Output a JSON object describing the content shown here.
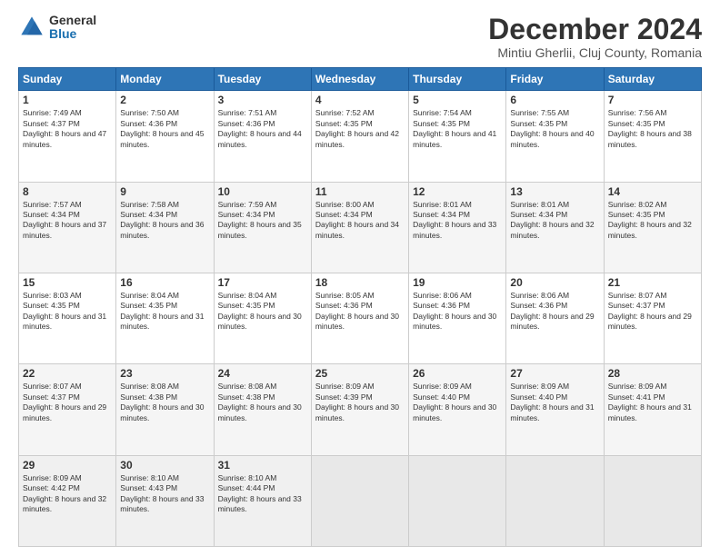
{
  "logo": {
    "general": "General",
    "blue": "Blue"
  },
  "header": {
    "title": "December 2024",
    "subtitle": "Mintiu Gherlii, Cluj County, Romania"
  },
  "weekdays": [
    "Sunday",
    "Monday",
    "Tuesday",
    "Wednesday",
    "Thursday",
    "Friday",
    "Saturday"
  ],
  "weeks": [
    [
      {
        "day": "1",
        "sunrise": "7:49 AM",
        "sunset": "4:37 PM",
        "daylight": "8 hours and 47 minutes."
      },
      {
        "day": "2",
        "sunrise": "7:50 AM",
        "sunset": "4:36 PM",
        "daylight": "8 hours and 45 minutes."
      },
      {
        "day": "3",
        "sunrise": "7:51 AM",
        "sunset": "4:36 PM",
        "daylight": "8 hours and 44 minutes."
      },
      {
        "day": "4",
        "sunrise": "7:52 AM",
        "sunset": "4:35 PM",
        "daylight": "8 hours and 42 minutes."
      },
      {
        "day": "5",
        "sunrise": "7:54 AM",
        "sunset": "4:35 PM",
        "daylight": "8 hours and 41 minutes."
      },
      {
        "day": "6",
        "sunrise": "7:55 AM",
        "sunset": "4:35 PM",
        "daylight": "8 hours and 40 minutes."
      },
      {
        "day": "7",
        "sunrise": "7:56 AM",
        "sunset": "4:35 PM",
        "daylight": "8 hours and 38 minutes."
      }
    ],
    [
      {
        "day": "8",
        "sunrise": "7:57 AM",
        "sunset": "4:34 PM",
        "daylight": "8 hours and 37 minutes."
      },
      {
        "day": "9",
        "sunrise": "7:58 AM",
        "sunset": "4:34 PM",
        "daylight": "8 hours and 36 minutes."
      },
      {
        "day": "10",
        "sunrise": "7:59 AM",
        "sunset": "4:34 PM",
        "daylight": "8 hours and 35 minutes."
      },
      {
        "day": "11",
        "sunrise": "8:00 AM",
        "sunset": "4:34 PM",
        "daylight": "8 hours and 34 minutes."
      },
      {
        "day": "12",
        "sunrise": "8:01 AM",
        "sunset": "4:34 PM",
        "daylight": "8 hours and 33 minutes."
      },
      {
        "day": "13",
        "sunrise": "8:01 AM",
        "sunset": "4:34 PM",
        "daylight": "8 hours and 32 minutes."
      },
      {
        "day": "14",
        "sunrise": "8:02 AM",
        "sunset": "4:35 PM",
        "daylight": "8 hours and 32 minutes."
      }
    ],
    [
      {
        "day": "15",
        "sunrise": "8:03 AM",
        "sunset": "4:35 PM",
        "daylight": "8 hours and 31 minutes."
      },
      {
        "day": "16",
        "sunrise": "8:04 AM",
        "sunset": "4:35 PM",
        "daylight": "8 hours and 31 minutes."
      },
      {
        "day": "17",
        "sunrise": "8:04 AM",
        "sunset": "4:35 PM",
        "daylight": "8 hours and 30 minutes."
      },
      {
        "day": "18",
        "sunrise": "8:05 AM",
        "sunset": "4:36 PM",
        "daylight": "8 hours and 30 minutes."
      },
      {
        "day": "19",
        "sunrise": "8:06 AM",
        "sunset": "4:36 PM",
        "daylight": "8 hours and 30 minutes."
      },
      {
        "day": "20",
        "sunrise": "8:06 AM",
        "sunset": "4:36 PM",
        "daylight": "8 hours and 29 minutes."
      },
      {
        "day": "21",
        "sunrise": "8:07 AM",
        "sunset": "4:37 PM",
        "daylight": "8 hours and 29 minutes."
      }
    ],
    [
      {
        "day": "22",
        "sunrise": "8:07 AM",
        "sunset": "4:37 PM",
        "daylight": "8 hours and 29 minutes."
      },
      {
        "day": "23",
        "sunrise": "8:08 AM",
        "sunset": "4:38 PM",
        "daylight": "8 hours and 30 minutes."
      },
      {
        "day": "24",
        "sunrise": "8:08 AM",
        "sunset": "4:38 PM",
        "daylight": "8 hours and 30 minutes."
      },
      {
        "day": "25",
        "sunrise": "8:09 AM",
        "sunset": "4:39 PM",
        "daylight": "8 hours and 30 minutes."
      },
      {
        "day": "26",
        "sunrise": "8:09 AM",
        "sunset": "4:40 PM",
        "daylight": "8 hours and 30 minutes."
      },
      {
        "day": "27",
        "sunrise": "8:09 AM",
        "sunset": "4:40 PM",
        "daylight": "8 hours and 31 minutes."
      },
      {
        "day": "28",
        "sunrise": "8:09 AM",
        "sunset": "4:41 PM",
        "daylight": "8 hours and 31 minutes."
      }
    ],
    [
      {
        "day": "29",
        "sunrise": "8:09 AM",
        "sunset": "4:42 PM",
        "daylight": "8 hours and 32 minutes."
      },
      {
        "day": "30",
        "sunrise": "8:10 AM",
        "sunset": "4:43 PM",
        "daylight": "8 hours and 33 minutes."
      },
      {
        "day": "31",
        "sunrise": "8:10 AM",
        "sunset": "4:44 PM",
        "daylight": "8 hours and 33 minutes."
      },
      null,
      null,
      null,
      null
    ]
  ]
}
